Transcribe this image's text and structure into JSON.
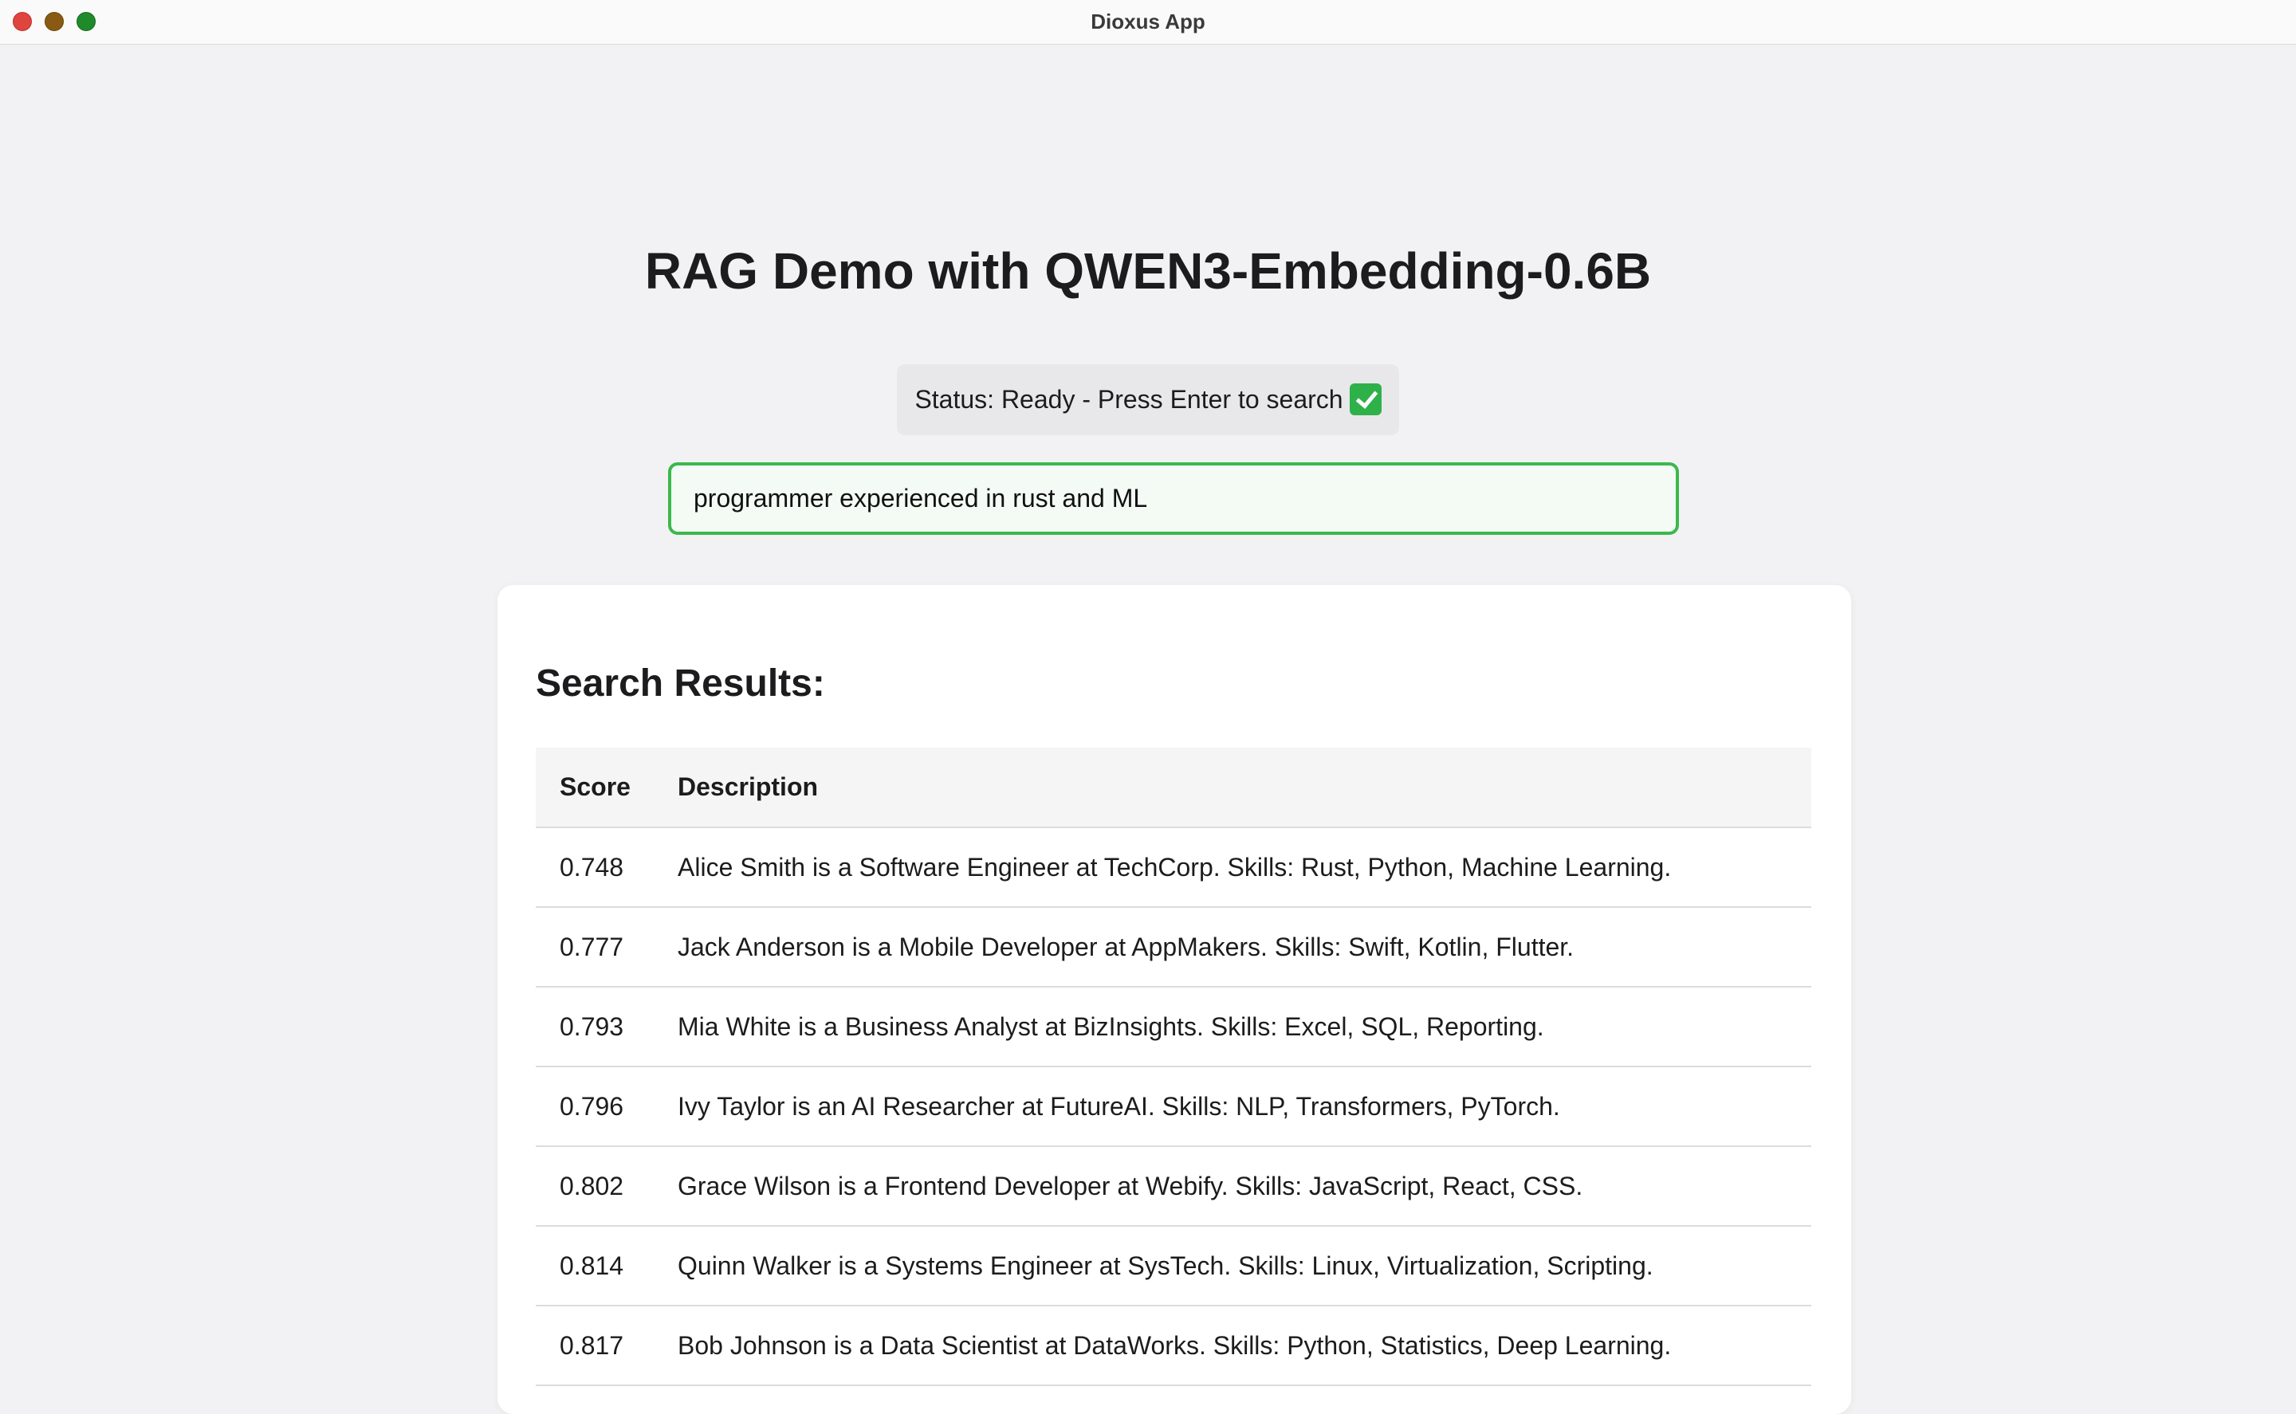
{
  "window": {
    "title": "Dioxus App"
  },
  "header": {
    "title": "RAG Demo with QWEN3-Embedding-0.6B"
  },
  "status": {
    "text": "Status: Ready - Press Enter to search",
    "icon": "check-mark-icon",
    "icon_color": "#2fb14a"
  },
  "search": {
    "value": "programmer experienced in rust and ML",
    "border_color": "#3cb84d"
  },
  "results": {
    "heading": "Search Results:",
    "columns": [
      "Score",
      "Description"
    ],
    "rows": [
      {
        "score": "0.748",
        "description": "Alice Smith is a Software Engineer at TechCorp. Skills: Rust, Python, Machine Learning."
      },
      {
        "score": "0.777",
        "description": "Jack Anderson is a Mobile Developer at AppMakers. Skills: Swift, Kotlin, Flutter."
      },
      {
        "score": "0.793",
        "description": "Mia White is a Business Analyst at BizInsights. Skills: Excel, SQL, Reporting."
      },
      {
        "score": "0.796",
        "description": "Ivy Taylor is an AI Researcher at FutureAI. Skills: NLP, Transformers, PyTorch."
      },
      {
        "score": "0.802",
        "description": "Grace Wilson is a Frontend Developer at Webify. Skills: JavaScript, React, CSS."
      },
      {
        "score": "0.814",
        "description": "Quinn Walker is a Systems Engineer at SysTech. Skills: Linux, Virtualization, Scripting."
      },
      {
        "score": "0.817",
        "description": "Bob Johnson is a Data Scientist at DataWorks. Skills: Python, Statistics, Deep Learning."
      }
    ]
  }
}
